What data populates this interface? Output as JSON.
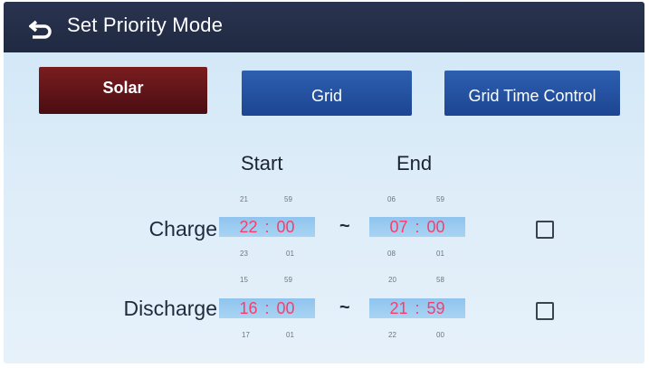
{
  "header": {
    "title": "Set Priority Mode"
  },
  "modes": {
    "solar": "Solar",
    "grid": "Grid",
    "grid_time_control": "Grid Time Control"
  },
  "columns": {
    "start": "Start",
    "end": "End"
  },
  "separator": "~",
  "rows": {
    "charge": {
      "label": "Charge",
      "start": {
        "hour": "22",
        "minute": "00",
        "hour_prev": "21",
        "hour_next": "23",
        "minute_prev": "59",
        "minute_next": "01"
      },
      "end": {
        "hour": "07",
        "minute": "00",
        "hour_prev": "06",
        "hour_next": "08",
        "minute_prev": "59",
        "minute_next": "01"
      }
    },
    "discharge": {
      "label": "Discharge",
      "start": {
        "hour": "16",
        "minute": "00",
        "hour_prev": "15",
        "hour_next": "17",
        "minute_prev": "59",
        "minute_next": "01"
      },
      "end": {
        "hour": "21",
        "minute": "59",
        "hour_prev": "20",
        "hour_next": "22",
        "minute_prev": "58",
        "minute_next": "00"
      }
    }
  },
  "colors": {
    "header_bg": "#222c46",
    "solar_active": "#6a1519",
    "mode_button": "#2553a3",
    "time_value": "#ff3a6a",
    "time_highlight": "#9ccdf0"
  }
}
